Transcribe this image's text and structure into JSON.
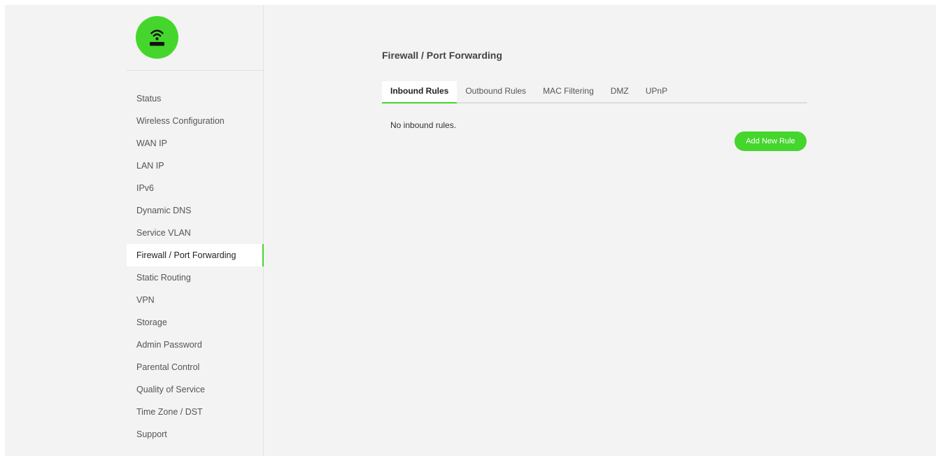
{
  "brand": {
    "logo_icon": "wifi-router-icon",
    "accent_color": "#44d62c"
  },
  "sidebar": {
    "items": [
      {
        "label": "Status"
      },
      {
        "label": "Wireless Configuration"
      },
      {
        "label": "WAN IP"
      },
      {
        "label": "LAN IP"
      },
      {
        "label": "IPv6"
      },
      {
        "label": "Dynamic DNS"
      },
      {
        "label": "Service VLAN"
      },
      {
        "label": "Firewall / Port Forwarding",
        "active": true
      },
      {
        "label": "Static Routing"
      },
      {
        "label": "VPN"
      },
      {
        "label": "Storage"
      },
      {
        "label": "Admin Password"
      },
      {
        "label": "Parental Control"
      },
      {
        "label": "Quality of Service"
      },
      {
        "label": "Time Zone / DST"
      },
      {
        "label": "Support"
      }
    ]
  },
  "main": {
    "title": "Firewall / Port Forwarding",
    "tabs": [
      {
        "label": "Inbound Rules",
        "active": true
      },
      {
        "label": "Outbound Rules"
      },
      {
        "label": "MAC Filtering"
      },
      {
        "label": "DMZ"
      },
      {
        "label": "UPnP"
      }
    ],
    "empty_message": "No inbound rules.",
    "add_button_label": "Add New Rule"
  }
}
